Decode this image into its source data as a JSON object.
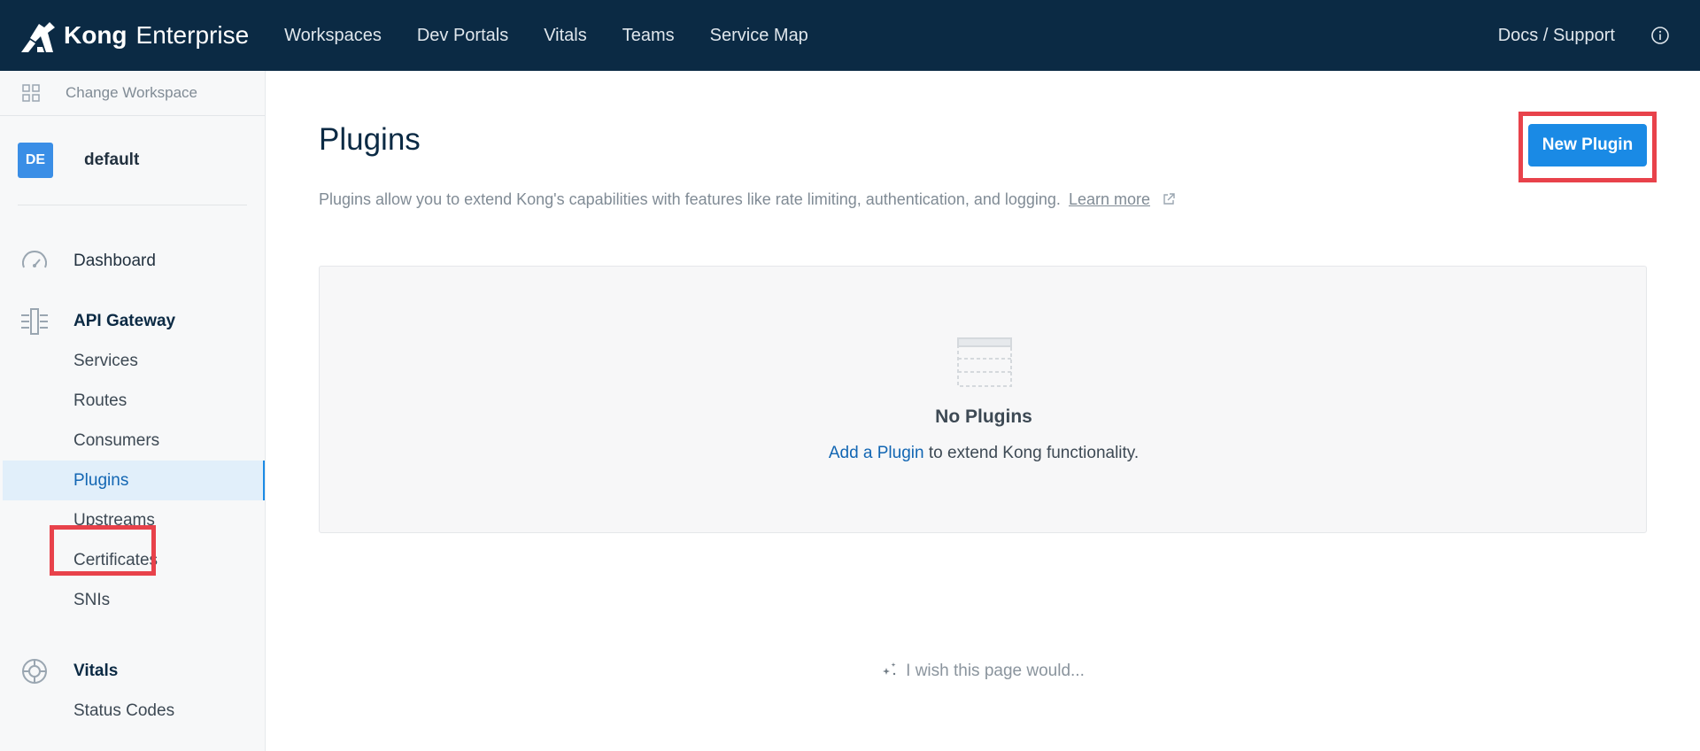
{
  "brand": {
    "name_bold": "Kong",
    "name_light": "Enterprise"
  },
  "nav": {
    "items": [
      "Workspaces",
      "Dev Portals",
      "Vitals",
      "Teams",
      "Service Map"
    ],
    "docs": "Docs / Support"
  },
  "sidebar": {
    "change_workspace": "Change Workspace",
    "workspace": {
      "badge": "DE",
      "name": "default"
    },
    "dashboard": "Dashboard",
    "api_gateway": {
      "title": "API Gateway",
      "items": [
        "Services",
        "Routes",
        "Consumers",
        "Plugins",
        "Upstreams",
        "Certificates",
        "SNIs"
      ],
      "active": "Plugins"
    },
    "vitals": {
      "title": "Vitals",
      "items": [
        "Status Codes"
      ]
    }
  },
  "main": {
    "title": "Plugins",
    "description": "Plugins allow you to extend Kong's capabilities with features like rate limiting, authentication, and logging.",
    "learn_more": "Learn more",
    "new_plugin": "New Plugin",
    "empty": {
      "title": "No Plugins",
      "link": "Add a Plugin",
      "text": " to extend Kong functionality."
    },
    "wish": "I wish this page would..."
  },
  "colors": {
    "topbar": "#0b2a44",
    "accent": "#1a8ae5",
    "highlight": "#e8424b"
  }
}
